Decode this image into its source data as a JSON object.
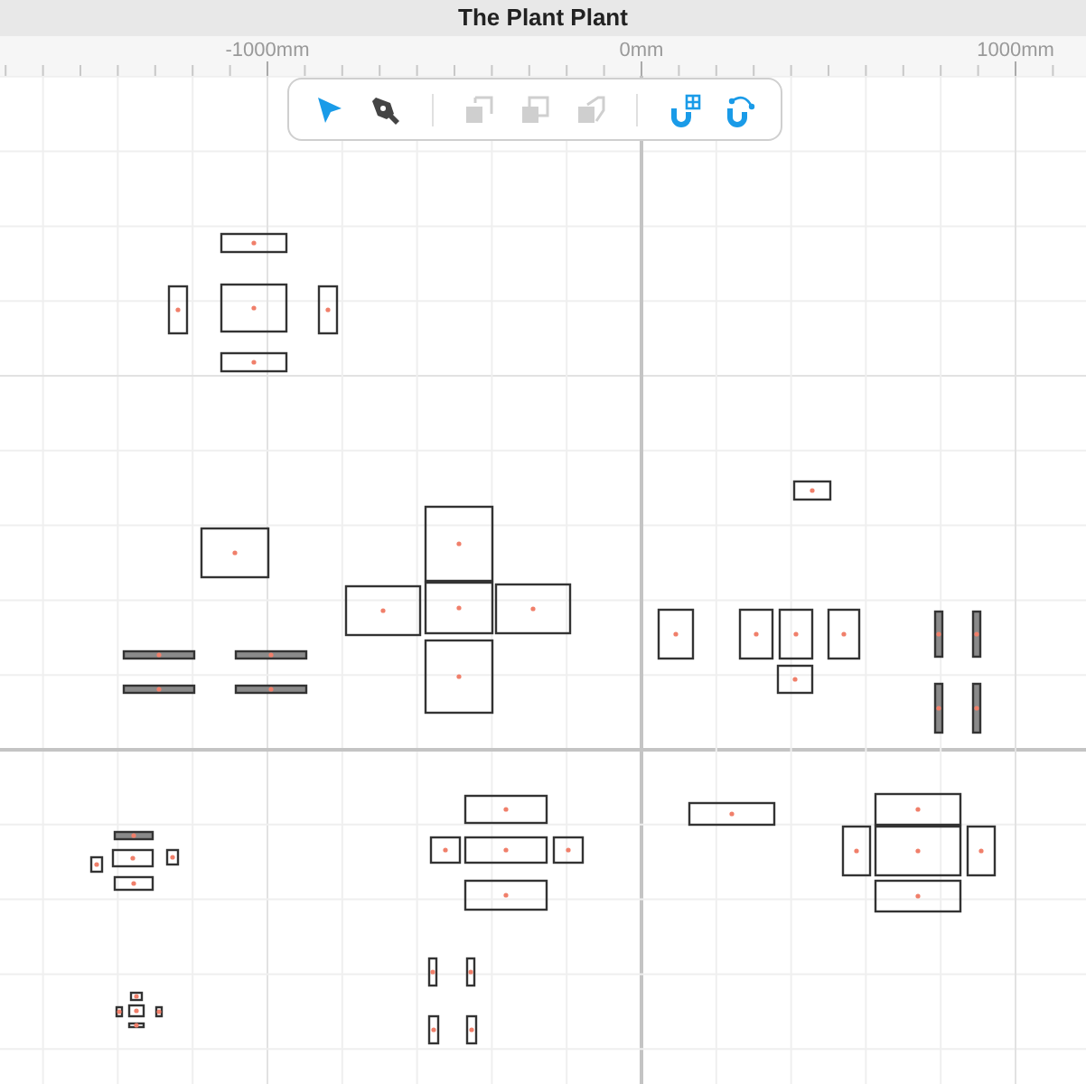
{
  "window": {
    "title": "The Plant Plant"
  },
  "ruler": {
    "labels": [
      "-1000mm",
      "0mm",
      "1000mm"
    ]
  },
  "toolbar": {
    "groups": [
      [
        {
          "kind": "select",
          "selected": true,
          "disabled": false
        },
        {
          "kind": "pen",
          "selected": false,
          "disabled": false
        }
      ],
      [
        {
          "kind": "back",
          "selected": false,
          "disabled": true
        },
        {
          "kind": "front",
          "selected": false,
          "disabled": true
        },
        {
          "kind": "flip",
          "selected": false,
          "disabled": true
        }
      ],
      [
        {
          "kind": "snap-grid",
          "selected": true,
          "disabled": false
        },
        {
          "kind": "snap-path",
          "selected": true,
          "disabled": false
        }
      ]
    ]
  }
}
